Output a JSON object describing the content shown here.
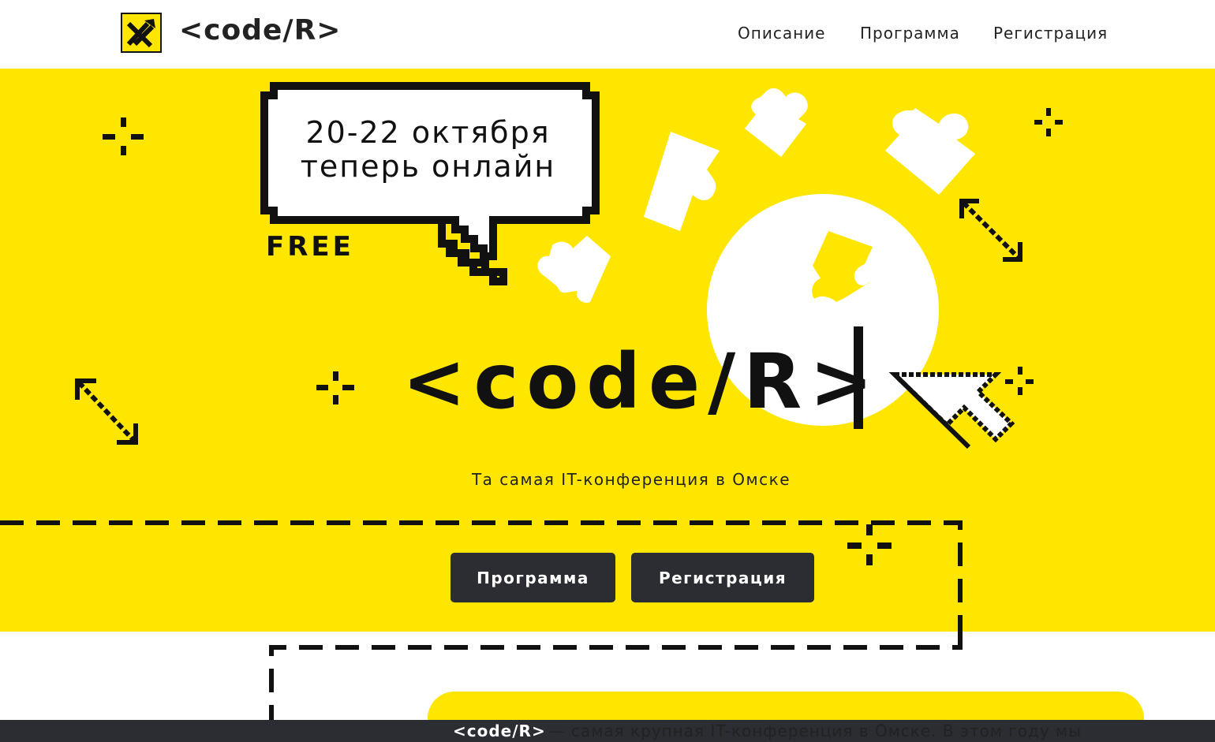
{
  "header": {
    "logo_text": "<code/R>",
    "nav": [
      "Описание",
      "Программа",
      "Регистрация"
    ]
  },
  "hero": {
    "bubble_line1": "20-22 октября",
    "bubble_line2": "теперь онлайн",
    "free": "FREE",
    "title": "<code/R>",
    "tagline": "Та самая IT-конференция в Омске",
    "buttons": [
      "Программа",
      "Регистрация"
    ]
  },
  "info": {
    "highlight": "<code/R>",
    "text": "— самая крупная IT-конференция в Омске. В этом году мы"
  },
  "colors": {
    "brand_yellow": "#fee600",
    "dark": "#2b2d33",
    "white": "#ffffff"
  },
  "icons": [
    "raiffeisen-logo-icon",
    "speech-bubble-icon",
    "puzzle-piece-icon",
    "sparkle-icon",
    "resize-arrow-icon",
    "pointer-cursor-icon",
    "text-cursor-icon"
  ]
}
